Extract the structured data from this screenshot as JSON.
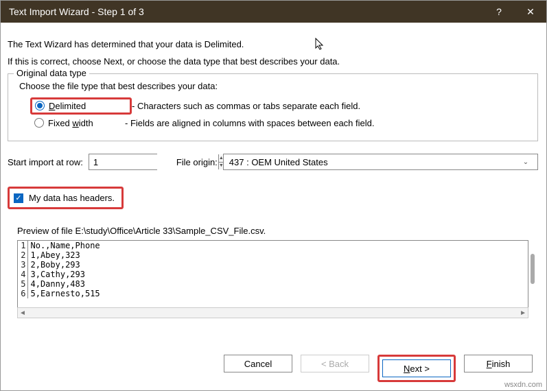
{
  "titlebar": {
    "title": "Text Import Wizard - Step 1 of 3",
    "help": "?",
    "close": "✕"
  },
  "intro": {
    "line1": "The Text Wizard has determined that your data is Delimited.",
    "line2": "If this is correct, choose Next, or choose the data type that best describes your data."
  },
  "original": {
    "legend": "Original data type",
    "prompt": "Choose the file type that best describes your data:",
    "delimited": {
      "label_pre": "D",
      "label_rest": "elimited",
      "desc": "- Characters such as commas or tabs separate each field."
    },
    "fixed": {
      "label_pre": "Fixed ",
      "label_u": "w",
      "label_rest": "idth",
      "desc": "- Fields are aligned in columns with spaces between each field."
    }
  },
  "start": {
    "label_pre": "Start import at ",
    "label_u": "r",
    "label_rest": "ow:",
    "value": "1",
    "file_origin_label": "File origin:",
    "file_origin_value": "437 : OEM United States"
  },
  "headers": {
    "label_u": "M",
    "label_rest": "y data has headers."
  },
  "preview": {
    "label": "Preview of file E:\\study\\Office\\Article 33\\Sample_CSV_File.csv.",
    "rows": [
      "No.,Name,Phone",
      "1,Abey,323",
      "2,Boby,293",
      "3,Cathy,293",
      "4,Danny,483",
      "5,Earnesto,515"
    ]
  },
  "buttons": {
    "cancel": "Cancel",
    "back": "< Back",
    "next_u": "N",
    "next_rest": "ext >",
    "finish_u": "F",
    "finish_rest": "inish"
  },
  "watermark": "wsxdn.com"
}
